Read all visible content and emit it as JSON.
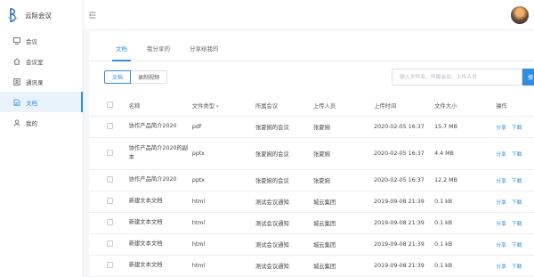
{
  "app": {
    "name": "云际会议"
  },
  "sidebar": {
    "items": [
      {
        "label": "会议",
        "icon": "meeting-icon"
      },
      {
        "label": "会议室",
        "icon": "home-icon"
      },
      {
        "label": "通讯录",
        "icon": "contacts-icon"
      },
      {
        "label": "文档",
        "icon": "document-icon",
        "active": true
      },
      {
        "label": "我的",
        "icon": "user-icon"
      }
    ]
  },
  "tabs": [
    {
      "label": "文档",
      "active": true
    },
    {
      "label": "我分享的"
    },
    {
      "label": "分享给我的"
    }
  ],
  "filter": {
    "segments": [
      "文档",
      "录制视频"
    ],
    "search_placeholder": "输入文件名、所属会议、上传人员",
    "search_button": "搜"
  },
  "table": {
    "headers": [
      "名称",
      "文件类型",
      "所属会议",
      "上传人员",
      "上传时间",
      "文件大小",
      "操作"
    ],
    "rows": [
      {
        "name": "协作产品简介2020",
        "type": "pdf",
        "meeting": "张夏婉的会议",
        "uploader": "张夏婉",
        "time": "2020-02-05 16:37",
        "size": "15.7 MB",
        "share": "分享",
        "download": "下载"
      },
      {
        "name": "协作产品简介2020的副本",
        "type": "pptx",
        "meeting": "张夏婉的会议",
        "uploader": "张夏婉",
        "time": "2020-02-05 16:37",
        "size": "4.4 MB",
        "share": "分享",
        "download": "下载"
      },
      {
        "name": "协作产品简介2020",
        "type": "pptx",
        "meeting": "张夏婉的会议",
        "uploader": "张夏婉",
        "time": "2020-02-05 16:37",
        "size": "12.2 MB",
        "share": "分享",
        "download": "下载"
      },
      {
        "name": "新建文本文档",
        "type": "html",
        "meeting": "测试会议通知",
        "uploader": "城云集团",
        "time": "2019-09-08 21:39",
        "size": "0.1 kB",
        "share": "分享",
        "download": "下载"
      },
      {
        "name": "新建文本文档",
        "type": "html",
        "meeting": "测试会议通知",
        "uploader": "城云集团",
        "time": "2019-09-08 21:39",
        "size": "0.1 kB",
        "share": "分享",
        "download": "下载"
      },
      {
        "name": "新建文本文档",
        "type": "html",
        "meeting": "测试会议通知",
        "uploader": "城云集团",
        "time": "2019-09-08 21:39",
        "size": "0.1 kB",
        "share": "分享",
        "download": "下载"
      },
      {
        "name": "新建文本文档",
        "type": "html",
        "meeting": "测试会议通知",
        "uploader": "城云集团",
        "time": "2019-09-08 21:39",
        "size": "0.1 kB",
        "share": "分享",
        "download": "下载"
      }
    ]
  },
  "colors": {
    "accent": "#2f8de4",
    "active_bg": "#e9f3fc",
    "page_bg": "#f4f6f9"
  }
}
